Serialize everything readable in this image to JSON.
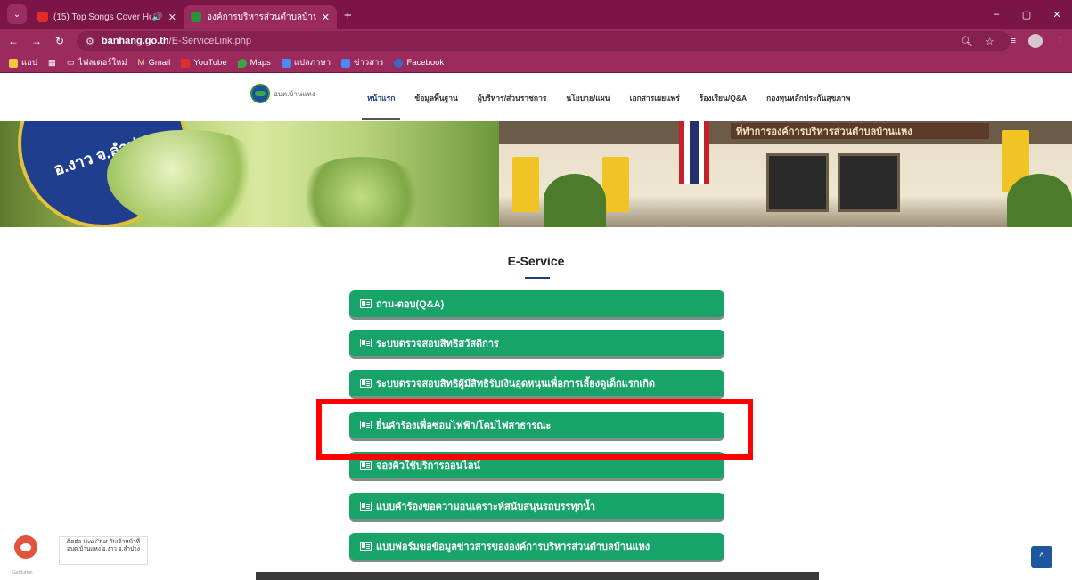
{
  "browser": {
    "tabs": [
      {
        "title": "(15) Top Songs Cover Hot Hi",
        "audio": "🔊",
        "active": false
      },
      {
        "title": "องค์การบริหารส่วนตำบลบ้านแหง อ.งา",
        "active": true
      }
    ],
    "new_tab": "+",
    "window_controls": [
      "–",
      "▢",
      "✕"
    ],
    "url_host": "banhang.go.th",
    "url_path": "/E-ServiceLink.php",
    "bookmarks": [
      {
        "label": "แอป",
        "icon": "apps-icon"
      },
      {
        "label": "ไฟลเดอร์ใหม่",
        "icon": "folder-icon"
      },
      {
        "label": "Gmail",
        "icon": "gmail-icon"
      },
      {
        "label": "YouTube",
        "icon": "youtube-icon"
      },
      {
        "label": "Maps",
        "icon": "maps-icon"
      },
      {
        "label": "แปลภาษา",
        "icon": "translate-icon"
      },
      {
        "label": "ข่าวสาร",
        "icon": "news-icon"
      },
      {
        "label": "Facebook",
        "icon": "facebook-icon"
      }
    ]
  },
  "site": {
    "logo_text": "อบต.บ้านแหง",
    "nav": [
      {
        "label": "หน้าแรก",
        "active": true
      },
      {
        "label": "ข้อมูลพื้นฐาน",
        "active": false
      },
      {
        "label": "ผู้บริหาร/ส่วนราชการ",
        "active": false
      },
      {
        "label": "นโยบาย/แผน",
        "active": false
      },
      {
        "label": "เอกสารเผยแพร่",
        "active": false
      },
      {
        "label": "ร้องเรียน/Q&A",
        "active": false
      },
      {
        "label": "กองทุนหลักประกันสุขภาพ",
        "active": false
      }
    ],
    "banner": {
      "seal_text": "อ.งาว จ.ลำปาง",
      "sign_text": "ที่ทำการองค์การบริหารส่วนตำบลบ้านแหง"
    },
    "section_title": "E-Service",
    "services": [
      "ถาม-ตอบ(Q&A)",
      "ระบบตรวจสอบสิทธิสวัสดิการ",
      "ระบบตรวจสอบสิทธิผู้มีสิทธิรับเงินอุดหนุนเพื่อการเลี้ยงดูเด็กแรกเกิด",
      "ยื่นคำร้องเพื่อซ่อมไฟฟ้า/โคมไฟสาธารณะ",
      "จองคิวใช้บริการออนไลน์",
      "แบบคำร้องขอความอนุเคราะห์สนับสนุนรถบรรทุกน้ำ",
      "แบบฟอร์มขอข้อมูลข่าวสารขององค์การบริหารส่วนตำบลบ้านแหง"
    ],
    "chat": {
      "label": "ติดต่อ Live Chat กับเจ้าหน้าที่อบต.บ้านแหง อ.งาว จ.ลำปาง",
      "powered": "GetButton"
    },
    "scroll_top": "^"
  },
  "colors": {
    "browser_frame": "#9b2b5d",
    "service_button": "#18a468",
    "highlight": "#ff0000",
    "scroll_top": "#1e56a0"
  }
}
